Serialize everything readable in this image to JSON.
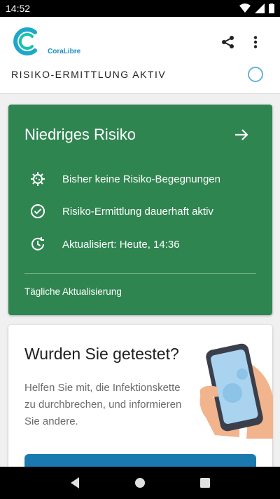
{
  "statusbar": {
    "time": "14:52"
  },
  "app": {
    "logo_text": "CoraLibre",
    "risk_status_title": "RISIKO-ERMITTLUNG AKTIV"
  },
  "risk_card": {
    "title": "Niedriges Risiko",
    "rows": [
      {
        "icon": "virus-icon",
        "text": "Bisher keine Risiko-Begegnungen"
      },
      {
        "icon": "check-circle-icon",
        "text": "Risiko-Ermittlung dauerhaft aktiv"
      },
      {
        "icon": "clock-refresh-icon",
        "text": "Aktualisiert: Heute, 14:36"
      }
    ],
    "footer": "Tägliche Aktualisierung",
    "color": "#2f8550"
  },
  "test_card": {
    "title": "Wurden Sie getestet?",
    "body": "Helfen Sie mit, die Infektionskette zu durchbrechen, und informieren Sie andere.",
    "button_color": "#1a7ab0"
  },
  "colors": {
    "accent": "#1a7ab0",
    "risk_green": "#2f8550",
    "status_ring": "#6bb2d8"
  }
}
